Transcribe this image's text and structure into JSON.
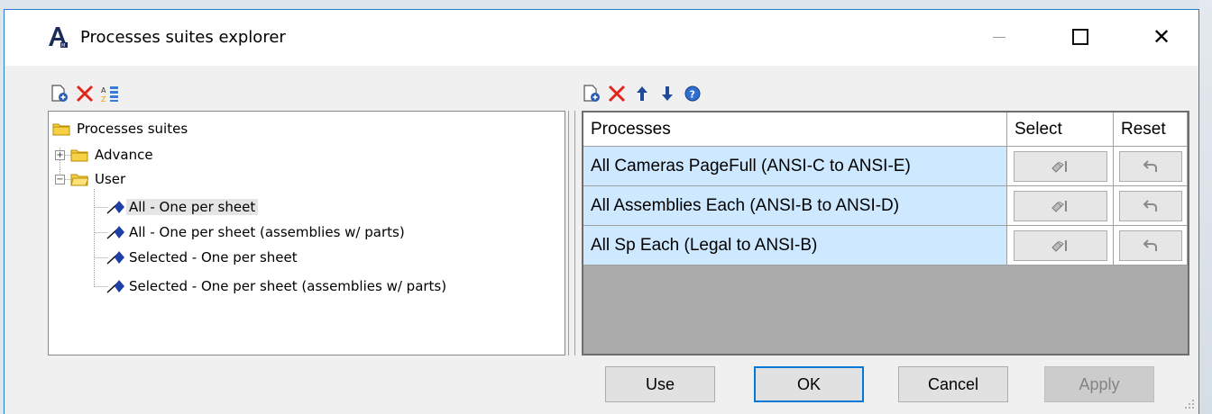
{
  "window": {
    "title": "Processes suites explorer",
    "app_icon": "autocad-a-icon"
  },
  "title_buttons": {
    "minimize": "minimize-icon",
    "maximize": "maximize-icon",
    "close": "close-icon",
    "close_glyph": "✕"
  },
  "toolbar_left": [
    "new-document-icon",
    "delete-icon",
    "sort-icon"
  ],
  "toolbar_right": [
    "new-document-icon",
    "delete-icon",
    "arrow-up-icon",
    "arrow-down-icon",
    "help-icon"
  ],
  "tree": {
    "root": "Processes suites",
    "advance": "Advance",
    "user": "User",
    "items": [
      "All - One per sheet",
      "All - One per sheet (assemblies w/ parts)",
      "Selected - One per sheet",
      "Selected - One per sheet (assemblies w/ parts)"
    ]
  },
  "grid": {
    "headers": {
      "processes": "Processes",
      "select": "Select",
      "reset": "Reset"
    },
    "rows": [
      {
        "name": "All Cameras PageFull (ANSI-C to ANSI-E)"
      },
      {
        "name": "All Assemblies Each (ANSI-B to ANSI-D)"
      },
      {
        "name": "All Sp Each (Legal to ANSI-B)"
      }
    ],
    "select_icon": "select-objects-icon",
    "reset_icon": "undo-arrow-icon"
  },
  "buttons": {
    "use": "Use",
    "ok": "OK",
    "cancel": "Cancel",
    "apply": "Apply"
  },
  "colors": {
    "selected_row": "#cde8ff",
    "grid_empty": "#ababab",
    "accent": "#0078d7"
  }
}
